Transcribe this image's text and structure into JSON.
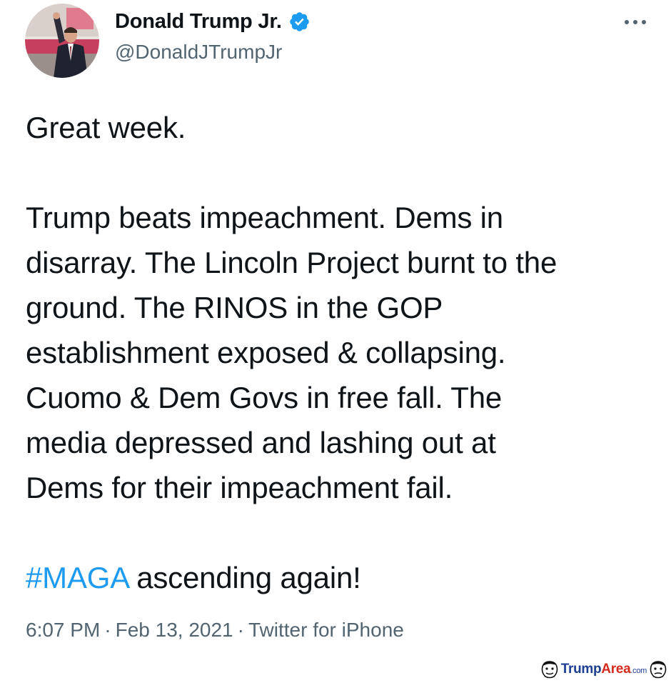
{
  "author": {
    "display_name": "Donald Trump Jr.",
    "handle": "@DonaldJTrumpJr",
    "avatar_icon": "profile-photo",
    "verified_icon": "verified-badge-icon",
    "verified_color": "#1d9bf0"
  },
  "menu": {
    "more_icon": "more-options-icon"
  },
  "tweet": {
    "para1": [
      "Great week."
    ],
    "para2": [
      "Trump beats impeachment. Dems in",
      "disarray. The Lincoln Project burnt to the",
      "ground. The RINOS in the GOP",
      "establishment exposed & collapsing.",
      "Cuomo & Dem Govs in free fall. The",
      "media depressed and lashing out at",
      "Dems for their impeachment fail."
    ],
    "para3": {
      "hashtag": "#MAGA",
      "rest": " ascending again!"
    },
    "hashtag_color": "#1d9bf0"
  },
  "meta": {
    "time": "6:07 PM",
    "separator": "·",
    "date": "Feb 13, 2021",
    "source": "Twitter for iPhone"
  },
  "watermark": {
    "part1": "Trump",
    "part2": "Area",
    "part3": ".com"
  }
}
